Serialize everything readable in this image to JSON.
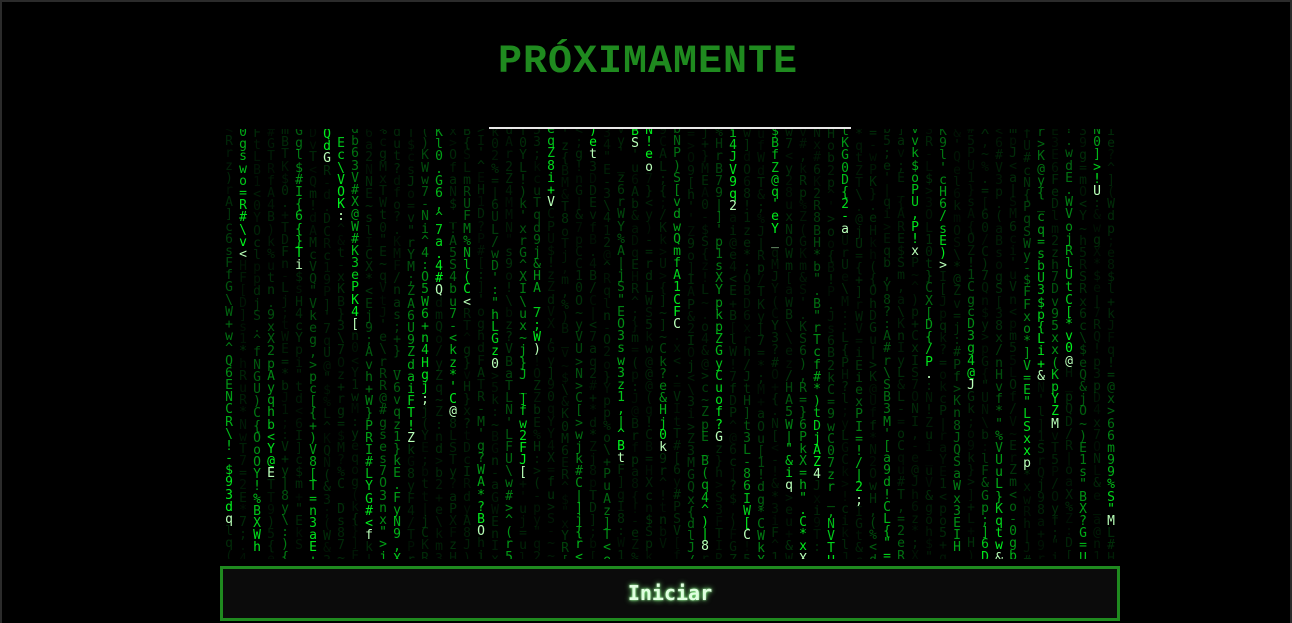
{
  "page": {
    "title": "PRÓXIMAMENTE"
  },
  "matrix_rain": {
    "charset": "ABCDEFGHIJKLMNOPQRSTUVWXYZabcdefghijklmnopqrstuvwxyz0123456789@#$%^&*()_+-=[]{}|;:,.<>?/\\~\"'!",
    "color": "#00ff41",
    "background": "#000000"
  },
  "actions": {
    "start_label": "Iniciar"
  },
  "colors": {
    "title": "#1f8a1f",
    "button_border": "#1f8a1f",
    "divider": "#e8e8e8"
  }
}
